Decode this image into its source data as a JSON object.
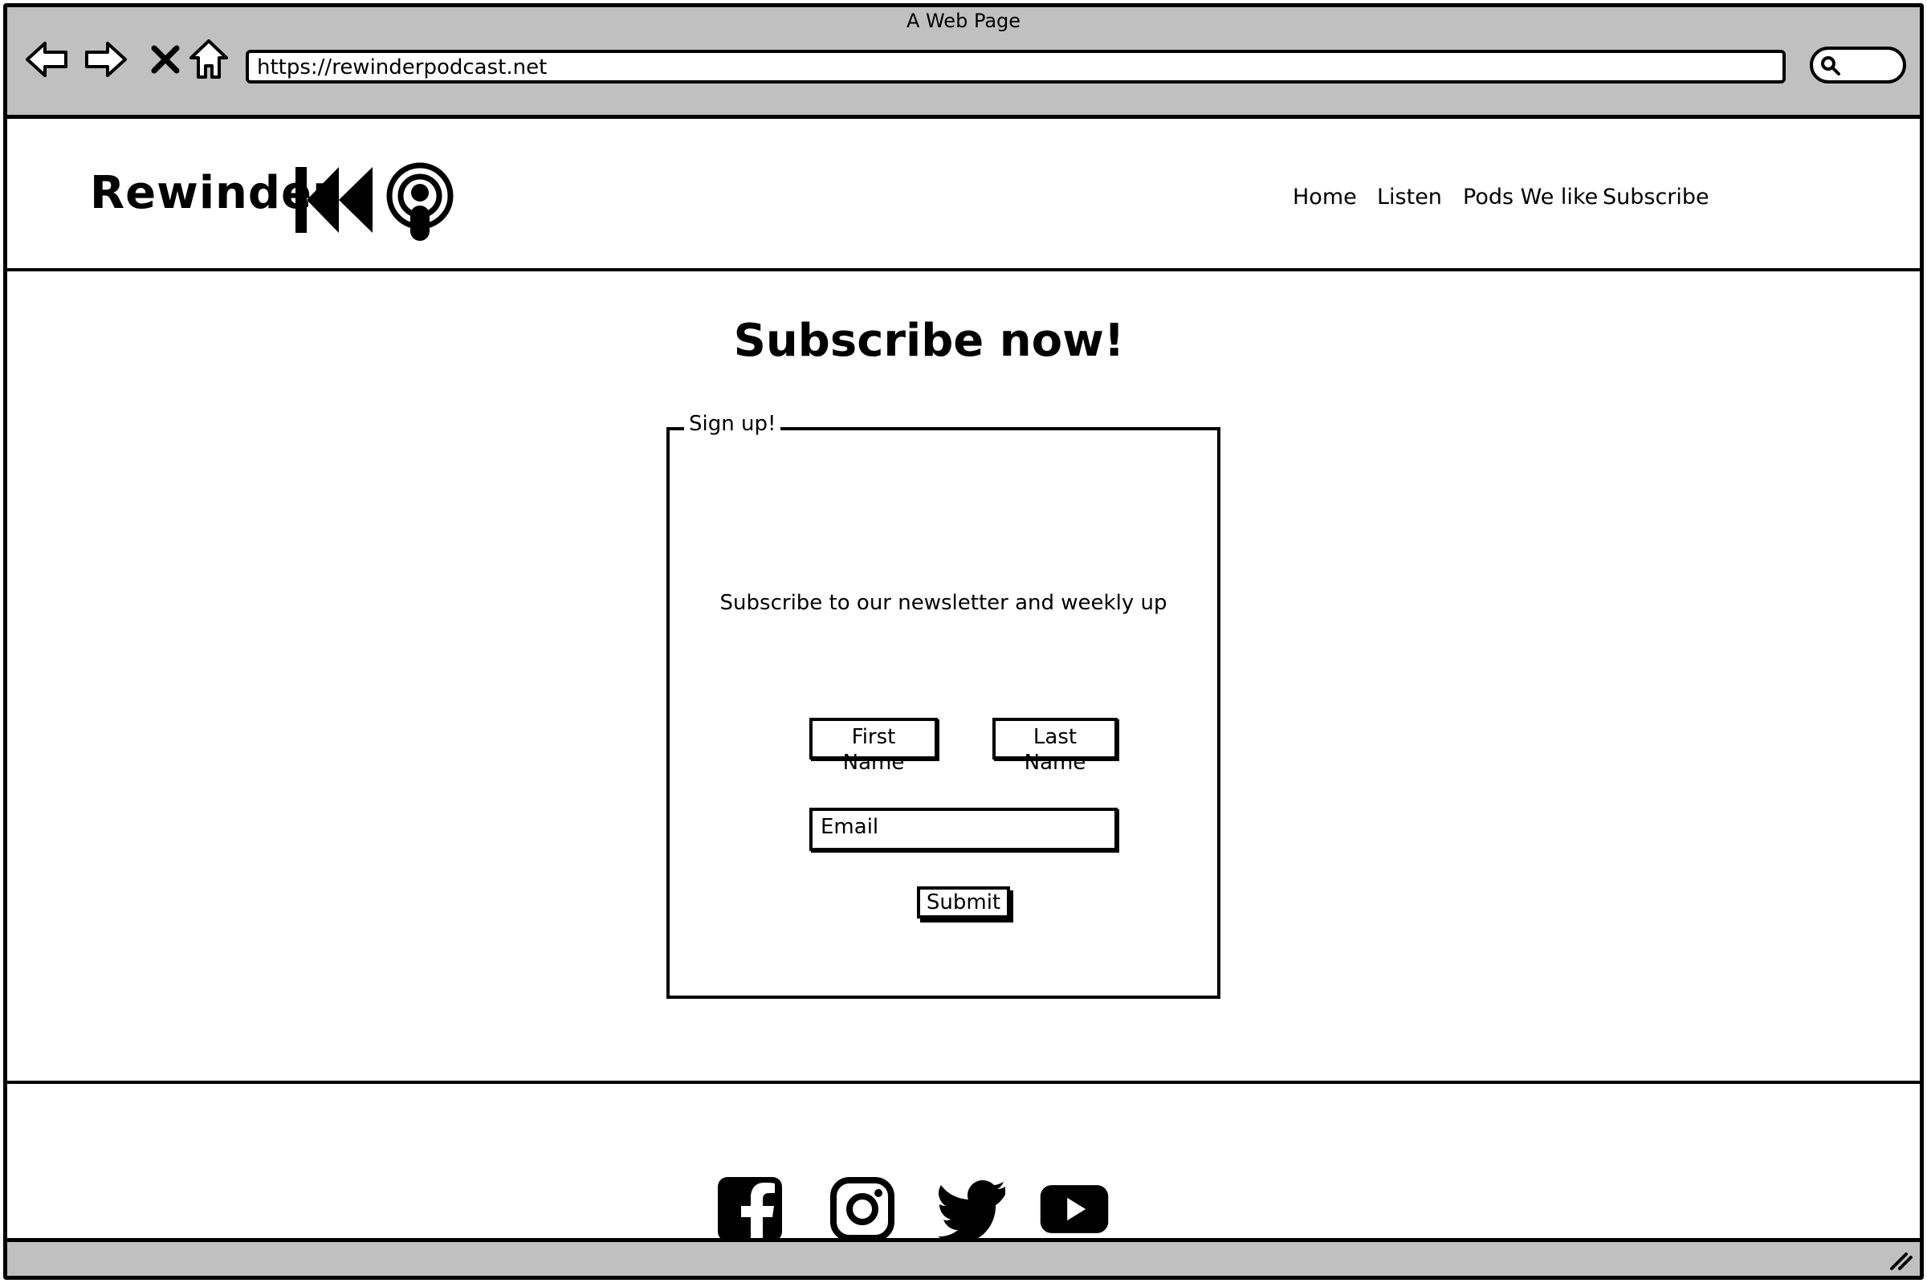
{
  "window": {
    "title": "A Web Page"
  },
  "browser": {
    "url": "https://rewinderpodcast.net",
    "icons": [
      "back-arrow-icon",
      "forward-arrow-icon",
      "stop-icon",
      "home-icon",
      "search-icon"
    ]
  },
  "header": {
    "brand": "Rewinder",
    "nav": [
      {
        "label": "Home"
      },
      {
        "label": "Listen"
      },
      {
        "label": "Pods We like"
      },
      {
        "label": "Subscribe"
      }
    ]
  },
  "main": {
    "title": "Subscribe now!",
    "signup": {
      "legend": "Sign up!",
      "description": "Subscribe to our newsletter and weekly up",
      "first_name": "First Name",
      "last_name": "Last Name",
      "email": "Email",
      "submit": "Submit"
    }
  },
  "footer": {
    "social": [
      "facebook-icon",
      "instagram-icon",
      "twitter-icon",
      "youtube-icon"
    ]
  }
}
